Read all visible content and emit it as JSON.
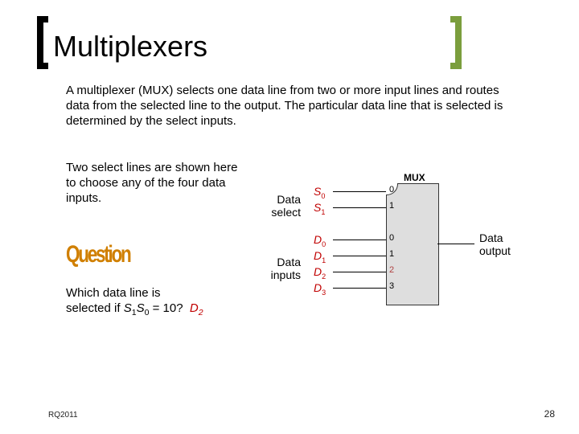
{
  "title": "Multiplexers",
  "intro": "A multiplexer (MUX) selects one data line from two or more input lines and routes data from the selected line to the output. The particular data line that is selected is determined by the select inputs.",
  "left_para": "Two select lines are shown here to choose any of the four data inputs.",
  "question_word": "Question",
  "question_line1": "Which data line is",
  "question_line2_prefix": "selected if ",
  "question_var1": "S",
  "question_sub1": "1",
  "question_var2": "S",
  "question_sub2": "0",
  "question_line2_suffix": " = 10?",
  "answer_var": "D",
  "answer_sub": "2",
  "diagram": {
    "mux_label": "MUX",
    "data_select_label": "Data select",
    "data_inputs_label": "Data inputs",
    "data_output_label": "Data output",
    "sel": [
      {
        "name": "S",
        "sub": "0",
        "pin": "0"
      },
      {
        "name": "S",
        "sub": "1",
        "pin": "1"
      }
    ],
    "din": [
      {
        "name": "D",
        "sub": "0",
        "pin": "0"
      },
      {
        "name": "D",
        "sub": "1",
        "pin": "1"
      },
      {
        "name": "D",
        "sub": "2",
        "pin": "2"
      },
      {
        "name": "D",
        "sub": "3",
        "pin": "3"
      }
    ]
  },
  "footer": {
    "left": "RQ2011",
    "right": "28"
  }
}
